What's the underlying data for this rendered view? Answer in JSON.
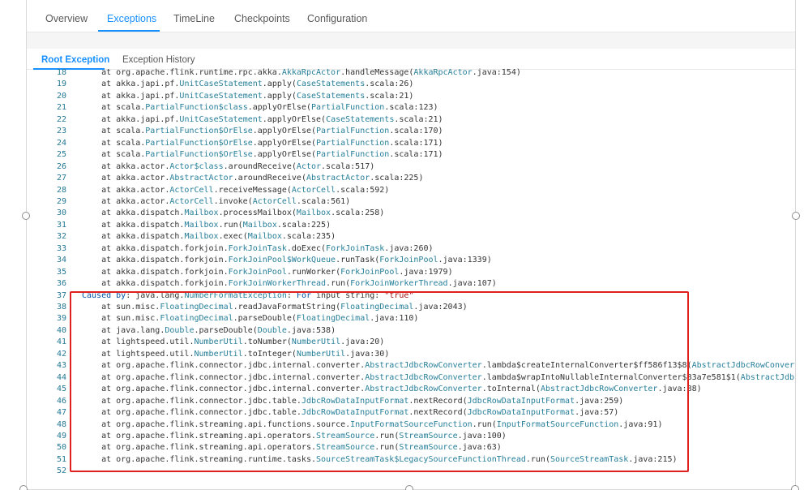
{
  "tabs": [
    "Overview",
    "Exceptions",
    "TimeLine",
    "Checkpoints",
    "Configuration"
  ],
  "active_tab": "Exceptions",
  "sub_tabs": [
    "Root Exception",
    "Exception History"
  ],
  "active_sub_tab": "Root Exception",
  "colors": {
    "accent": "#1890ff",
    "highlight_border": "#e0201e",
    "line_number": "#237893",
    "class_name": "#267f99"
  },
  "code_lines": [
    {
      "n": "18",
      "segs": [
        [
          "t",
          "    at org.apache.flink.runtime.rpc.akka."
        ],
        [
          "c",
          "AkkaRpcActor"
        ],
        [
          "t",
          ".handleMessage("
        ],
        [
          "c",
          "AkkaRpcActor"
        ],
        [
          "t",
          ".java:154)"
        ]
      ]
    },
    {
      "n": "19",
      "segs": [
        [
          "t",
          "    at akka.japi.pf."
        ],
        [
          "c",
          "UnitCaseStatement"
        ],
        [
          "t",
          ".apply("
        ],
        [
          "c",
          "CaseStatements"
        ],
        [
          "t",
          ".scala:26)"
        ]
      ]
    },
    {
      "n": "20",
      "segs": [
        [
          "t",
          "    at akka.japi.pf."
        ],
        [
          "c",
          "UnitCaseStatement"
        ],
        [
          "t",
          ".apply("
        ],
        [
          "c",
          "CaseStatements"
        ],
        [
          "t",
          ".scala:21)"
        ]
      ]
    },
    {
      "n": "21",
      "segs": [
        [
          "t",
          "    at scala."
        ],
        [
          "c",
          "PartialFunction$class"
        ],
        [
          "t",
          ".applyOrElse("
        ],
        [
          "c",
          "PartialFunction"
        ],
        [
          "t",
          ".scala:123)"
        ]
      ]
    },
    {
      "n": "22",
      "segs": [
        [
          "t",
          "    at akka.japi.pf."
        ],
        [
          "c",
          "UnitCaseStatement"
        ],
        [
          "t",
          ".applyOrElse("
        ],
        [
          "c",
          "CaseStatements"
        ],
        [
          "t",
          ".scala:21)"
        ]
      ]
    },
    {
      "n": "23",
      "segs": [
        [
          "t",
          "    at scala."
        ],
        [
          "c",
          "PartialFunction$OrElse"
        ],
        [
          "t",
          ".applyOrElse("
        ],
        [
          "c",
          "PartialFunction"
        ],
        [
          "t",
          ".scala:170)"
        ]
      ]
    },
    {
      "n": "24",
      "segs": [
        [
          "t",
          "    at scala."
        ],
        [
          "c",
          "PartialFunction$OrElse"
        ],
        [
          "t",
          ".applyOrElse("
        ],
        [
          "c",
          "PartialFunction"
        ],
        [
          "t",
          ".scala:171)"
        ]
      ]
    },
    {
      "n": "25",
      "segs": [
        [
          "t",
          "    at scala."
        ],
        [
          "c",
          "PartialFunction$OrElse"
        ],
        [
          "t",
          ".applyOrElse("
        ],
        [
          "c",
          "PartialFunction"
        ],
        [
          "t",
          ".scala:171)"
        ]
      ]
    },
    {
      "n": "26",
      "segs": [
        [
          "t",
          "    at akka.actor."
        ],
        [
          "c",
          "Actor$class"
        ],
        [
          "t",
          ".aroundReceive("
        ],
        [
          "c",
          "Actor"
        ],
        [
          "t",
          ".scala:517)"
        ]
      ]
    },
    {
      "n": "27",
      "segs": [
        [
          "t",
          "    at akka.actor."
        ],
        [
          "c",
          "AbstractActor"
        ],
        [
          "t",
          ".aroundReceive("
        ],
        [
          "c",
          "AbstractActor"
        ],
        [
          "t",
          ".scala:225)"
        ]
      ]
    },
    {
      "n": "28",
      "segs": [
        [
          "t",
          "    at akka.actor."
        ],
        [
          "c",
          "ActorCell"
        ],
        [
          "t",
          ".receiveMessage("
        ],
        [
          "c",
          "ActorCell"
        ],
        [
          "t",
          ".scala:592)"
        ]
      ]
    },
    {
      "n": "29",
      "segs": [
        [
          "t",
          "    at akka.actor."
        ],
        [
          "c",
          "ActorCell"
        ],
        [
          "t",
          ".invoke("
        ],
        [
          "c",
          "ActorCell"
        ],
        [
          "t",
          ".scala:561)"
        ]
      ]
    },
    {
      "n": "30",
      "segs": [
        [
          "t",
          "    at akka.dispatch."
        ],
        [
          "c",
          "Mailbox"
        ],
        [
          "t",
          ".processMailbox("
        ],
        [
          "c",
          "Mailbox"
        ],
        [
          "t",
          ".scala:258)"
        ]
      ]
    },
    {
      "n": "31",
      "segs": [
        [
          "t",
          "    at akka.dispatch."
        ],
        [
          "c",
          "Mailbox"
        ],
        [
          "t",
          ".run("
        ],
        [
          "c",
          "Mailbox"
        ],
        [
          "t",
          ".scala:225)"
        ]
      ]
    },
    {
      "n": "32",
      "segs": [
        [
          "t",
          "    at akka.dispatch."
        ],
        [
          "c",
          "Mailbox"
        ],
        [
          "t",
          ".exec("
        ],
        [
          "c",
          "Mailbox"
        ],
        [
          "t",
          ".scala:235)"
        ]
      ]
    },
    {
      "n": "33",
      "segs": [
        [
          "t",
          "    at akka.dispatch.forkjoin."
        ],
        [
          "c",
          "ForkJoinTask"
        ],
        [
          "t",
          ".doExec("
        ],
        [
          "c",
          "ForkJoinTask"
        ],
        [
          "t",
          ".java:260)"
        ]
      ]
    },
    {
      "n": "34",
      "segs": [
        [
          "t",
          "    at akka.dispatch.forkjoin."
        ],
        [
          "c",
          "ForkJoinPool$WorkQueue"
        ],
        [
          "t",
          ".runTask("
        ],
        [
          "c",
          "ForkJoinPool"
        ],
        [
          "t",
          ".java:1339)"
        ]
      ]
    },
    {
      "n": "35",
      "segs": [
        [
          "t",
          "    at akka.dispatch.forkjoin."
        ],
        [
          "c",
          "ForkJoinPool"
        ],
        [
          "t",
          ".runWorker("
        ],
        [
          "c",
          "ForkJoinPool"
        ],
        [
          "t",
          ".java:1979)"
        ]
      ]
    },
    {
      "n": "36",
      "segs": [
        [
          "t",
          "    at akka.dispatch.forkjoin."
        ],
        [
          "c",
          "ForkJoinWorkerThread"
        ],
        [
          "t",
          ".run("
        ],
        [
          "c",
          "ForkJoinWorkerThread"
        ],
        [
          "t",
          ".java:107)"
        ]
      ]
    },
    {
      "n": "37",
      "segs": [
        [
          "k",
          "Caused by"
        ],
        [
          "t",
          ": java.lang."
        ],
        [
          "c",
          "NumberFormatException"
        ],
        [
          "t",
          ": "
        ],
        [
          "k",
          "For"
        ],
        [
          "t",
          " input string: "
        ],
        [
          "s",
          "\"true\""
        ]
      ]
    },
    {
      "n": "38",
      "segs": [
        [
          "t",
          "    at sun.misc."
        ],
        [
          "c",
          "FloatingDecimal"
        ],
        [
          "t",
          ".readJavaFormatString("
        ],
        [
          "c",
          "FloatingDecimal"
        ],
        [
          "t",
          ".java:2043)"
        ]
      ]
    },
    {
      "n": "39",
      "segs": [
        [
          "t",
          "    at sun.misc."
        ],
        [
          "c",
          "FloatingDecimal"
        ],
        [
          "t",
          ".parseDouble("
        ],
        [
          "c",
          "FloatingDecimal"
        ],
        [
          "t",
          ".java:110)"
        ]
      ]
    },
    {
      "n": "40",
      "segs": [
        [
          "t",
          "    at java.lang."
        ],
        [
          "c",
          "Double"
        ],
        [
          "t",
          ".parseDouble("
        ],
        [
          "c",
          "Double"
        ],
        [
          "t",
          ".java:538)"
        ]
      ]
    },
    {
      "n": "41",
      "segs": [
        [
          "t",
          "    at lightspeed.util."
        ],
        [
          "c",
          "NumberUtil"
        ],
        [
          "t",
          ".toNumber("
        ],
        [
          "c",
          "NumberUtil"
        ],
        [
          "t",
          ".java:20)"
        ]
      ]
    },
    {
      "n": "42",
      "segs": [
        [
          "t",
          "    at lightspeed.util."
        ],
        [
          "c",
          "NumberUtil"
        ],
        [
          "t",
          ".toInteger("
        ],
        [
          "c",
          "NumberUtil"
        ],
        [
          "t",
          ".java:30)"
        ]
      ]
    },
    {
      "n": "43",
      "segs": [
        [
          "t",
          "    at org.apache.flink.connector.jdbc.internal.converter."
        ],
        [
          "c",
          "AbstractJdbcRowConverter"
        ],
        [
          "t",
          ".lambda$createInternalConverter$ff586f13$8("
        ],
        [
          "c",
          "AbstractJdbcRowConverter."
        ]
      ]
    },
    {
      "n": "44",
      "segs": [
        [
          "t",
          "    at org.apache.flink.connector.jdbc.internal.converter."
        ],
        [
          "c",
          "AbstractJdbcRowConverter"
        ],
        [
          "t",
          ".lambda$wrapIntoNullableInternalConverter$83a7e581$1("
        ],
        [
          "c",
          "AbstractJdbcRow"
        ]
      ]
    },
    {
      "n": "45",
      "segs": [
        [
          "t",
          "    at org.apache.flink.connector.jdbc.internal.converter."
        ],
        [
          "c",
          "AbstractJdbcRowConverter"
        ],
        [
          "t",
          ".toInternal("
        ],
        [
          "c",
          "AbstractJdbcRowConverter"
        ],
        [
          "t",
          ".java:88)"
        ]
      ]
    },
    {
      "n": "46",
      "segs": [
        [
          "t",
          "    at org.apache.flink.connector.jdbc.table."
        ],
        [
          "c",
          "JdbcRowDataInputFormat"
        ],
        [
          "t",
          ".nextRecord("
        ],
        [
          "c",
          "JdbcRowDataInputFormat"
        ],
        [
          "t",
          ".java:259)"
        ]
      ]
    },
    {
      "n": "47",
      "segs": [
        [
          "t",
          "    at org.apache.flink.connector.jdbc.table."
        ],
        [
          "c",
          "JdbcRowDataInputFormat"
        ],
        [
          "t",
          ".nextRecord("
        ],
        [
          "c",
          "JdbcRowDataInputFormat"
        ],
        [
          "t",
          ".java:57)"
        ]
      ]
    },
    {
      "n": "48",
      "segs": [
        [
          "t",
          "    at org.apache.flink.streaming.api.functions.source."
        ],
        [
          "c",
          "InputFormatSourceFunction"
        ],
        [
          "t",
          ".run("
        ],
        [
          "c",
          "InputFormatSourceFunction"
        ],
        [
          "t",
          ".java:91)"
        ]
      ]
    },
    {
      "n": "49",
      "segs": [
        [
          "t",
          "    at org.apache.flink.streaming.api.operators."
        ],
        [
          "c",
          "StreamSource"
        ],
        [
          "t",
          ".run("
        ],
        [
          "c",
          "StreamSource"
        ],
        [
          "t",
          ".java:100)"
        ]
      ]
    },
    {
      "n": "50",
      "segs": [
        [
          "t",
          "    at org.apache.flink.streaming.api.operators."
        ],
        [
          "c",
          "StreamSource"
        ],
        [
          "t",
          ".run("
        ],
        [
          "c",
          "StreamSource"
        ],
        [
          "t",
          ".java:63)"
        ]
      ]
    },
    {
      "n": "51",
      "segs": [
        [
          "t",
          "    at org.apache.flink.streaming.runtime.tasks."
        ],
        [
          "c",
          "SourceStreamTask$LegacySourceFunctionThread"
        ],
        [
          "t",
          ".run("
        ],
        [
          "c",
          "SourceStreamTask"
        ],
        [
          "t",
          ".java:215)"
        ]
      ]
    },
    {
      "n": "52",
      "segs": []
    }
  ]
}
